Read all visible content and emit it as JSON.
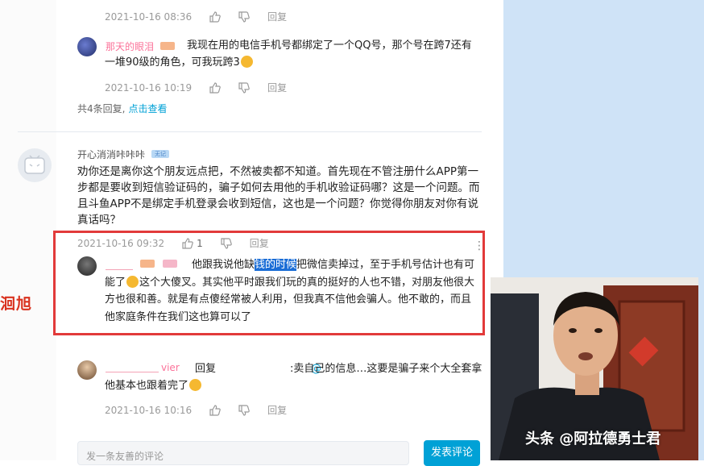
{
  "thread": {
    "top_reply_time": "2021-10-16 08:36",
    "reply2": {
      "username": "那天的眼泪",
      "text": "我现在用的电信手机号都绑定了一个QQ号，那个号在跨7还有一堆90级的角色，可我玩跨3",
      "time": "2021-10-16 10:19"
    },
    "summary_prefix": "共4条回复,",
    "summary_link": "点击查看"
  },
  "comment": {
    "username": "开心消消咔咔咔",
    "badge": "无记",
    "text": "劝你还是离你这个朋友远点把，不然被卖都不知道。首先现在不管注册什么APP第一步都是要收到短信验证码的，骗子如何去用他的手机收验证码哪？这是一个问题。而且斗鱼APP不是绑定手机登录会收到短信，这也是一个问题？你觉得你朋友对你有说真话吗？",
    "time": "2021-10-16 09:32",
    "like_count": "1"
  },
  "highlighted_reply": {
    "text_before": "他跟我说他缺",
    "highlighted": "钱的时候",
    "text_after": "把微信卖掉过，至于手机号估计也有可能了",
    "text_after_emoji": "这个大傻叉。其实他平时跟我们玩的真的挺好的人也不错，对朋友他很大方也很和善。就是有点傻经常被人利用，但我真不信他会骗人。他不敢的，而且他家庭条件在我们这也算可以了"
  },
  "reply4": {
    "username_suffix": "vier",
    "reply_word": "回复",
    "text": ":卖自己的信息…这要是骗子来个大全套拿他基本也跟着完了",
    "time": "2021-10-16 10:16"
  },
  "labels": {
    "reply_btn": "回复"
  },
  "side_text": "洄旭",
  "input_placeholder": "发一条友善的评论",
  "submit_label": "发表评论",
  "watermark": "头条 @阿拉德勇士君",
  "colors": {
    "highlight_box": "#e23a3a",
    "accent": "#00a1d6",
    "username_pink": "#fb7299"
  }
}
